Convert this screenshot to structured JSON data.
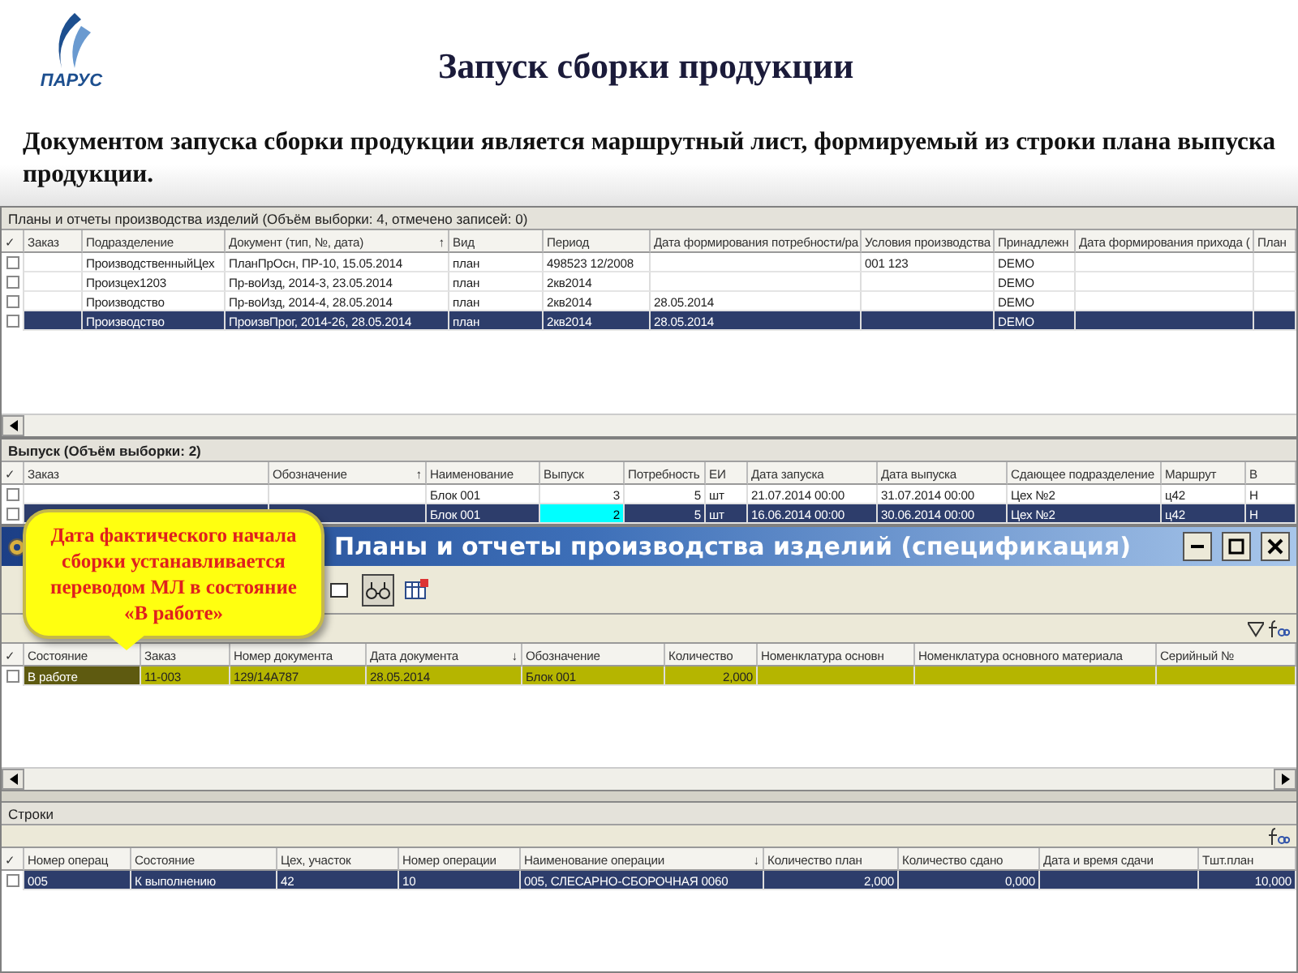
{
  "logo": {
    "text": "ПАРУС"
  },
  "slide": {
    "title": "Запуск сборки продукции",
    "text": "Документом запуска сборки продукции является маршрутный лист, формируемый из строки плана выпуска продукции."
  },
  "plans_window": {
    "caption": "Планы и отчеты производства изделий (Объём выборки: 4, отмечено записей: 0)",
    "check_header": "✓",
    "columns": [
      {
        "label": "Заказ"
      },
      {
        "label": "Подразделение"
      },
      {
        "label": "Документ (тип, №, дата)",
        "sort": "↑"
      },
      {
        "label": "Вид"
      },
      {
        "label": "Период"
      },
      {
        "label": "Дата формирования потребности/ра"
      },
      {
        "label": "Условия производства"
      },
      {
        "label": "Принадлежн"
      },
      {
        "label": "Дата формирования прихода ("
      },
      {
        "label": "План"
      }
    ],
    "rows": [
      {
        "checked": false,
        "selected": false,
        "cells": [
          "",
          "ПроизводственныйЦех",
          "ПланПрОсн, ПР-10, 15.05.2014",
          "план",
          "498523 12/2008",
          "",
          "001 123",
          "DEMO",
          "",
          ""
        ]
      },
      {
        "checked": false,
        "selected": false,
        "cells": [
          "",
          "Произцех1203",
          "Пр-воИзд, 2014-3, 23.05.2014",
          "план",
          "2кв2014",
          "",
          "",
          "DEMO",
          "",
          ""
        ]
      },
      {
        "checked": false,
        "selected": false,
        "cells": [
          "",
          "Производство",
          "Пр-воИзд, 2014-4, 28.05.2014",
          "план",
          "2кв2014",
          "28.05.2014",
          "",
          "DEMO",
          "",
          ""
        ]
      },
      {
        "checked": false,
        "selected": true,
        "cells": [
          "",
          "Производство",
          "ПроизвПрог, 2014-26, 28.05.2014",
          "план",
          "2кв2014",
          "28.05.2014",
          "",
          "DEMO",
          "",
          ""
        ]
      }
    ]
  },
  "release_panel": {
    "caption": "Выпуск (Объём выборки: 2)",
    "check_header": "✓",
    "columns": [
      {
        "label": "Заказ"
      },
      {
        "label": "Обозначение",
        "sort": "↑"
      },
      {
        "label": "Наименование"
      },
      {
        "label": "Выпуск",
        "numeric": true
      },
      {
        "label": "Потребность",
        "numeric": true
      },
      {
        "label": "ЕИ"
      },
      {
        "label": "Дата запуска"
      },
      {
        "label": "Дата выпуска"
      },
      {
        "label": "Сдающее подразделение"
      },
      {
        "label": "Маршрут"
      },
      {
        "label": "В"
      }
    ],
    "rows": [
      {
        "checked": false,
        "selected": false,
        "cells": [
          "",
          "",
          "Блок 001",
          "3",
          "5",
          "шт",
          "21.07.2014 00:00",
          "31.07.2014 00:00",
          "Цех №2",
          "ц42",
          "Н"
        ]
      },
      {
        "checked": false,
        "selected": true,
        "cells": [
          "",
          "",
          "Блок 001",
          {
            "text": "2",
            "editing": true
          },
          "5",
          "шт",
          "16.06.2014 00:00",
          "30.06.2014 00:00",
          "Цех №2",
          "ц42",
          "Н"
        ]
      }
    ]
  },
  "spec_window": {
    "title": "Планы и отчеты производства изделий (спецификация)",
    "focused": false,
    "check_header": "✓",
    "columns": [
      {
        "label": "Состояние"
      },
      {
        "label": "Заказ"
      },
      {
        "label": "Номер документа"
      },
      {
        "label": "Дата документа",
        "sort": "↓"
      },
      {
        "label": "Обозначение"
      },
      {
        "label": "Количество",
        "numeric": true
      },
      {
        "label": "Номенклатура основн"
      },
      {
        "label": "Номенклатура основного материала"
      },
      {
        "label": "Серийный №"
      }
    ],
    "rows": [
      {
        "checked": false,
        "selected": true,
        "cells": [
          "В работе",
          "11-003",
          "129/14А787",
          "28.05.2014",
          "Блок 001",
          "2,000",
          "",
          "",
          ""
        ]
      }
    ]
  },
  "rows_panel": {
    "caption": "Строки",
    "focused": true,
    "check_header": "✓",
    "columns": [
      {
        "label": "Номер операц"
      },
      {
        "label": "Состояние"
      },
      {
        "label": "Цех, участок"
      },
      {
        "label": "Номер операции"
      },
      {
        "label": "Наименование операции",
        "sort": "↓"
      },
      {
        "label": "Количество план",
        "numeric": true
      },
      {
        "label": "Количество сдано",
        "numeric": true
      },
      {
        "label": "Дата и время сдачи"
      },
      {
        "label": "Тшт.план",
        "numeric": true
      }
    ],
    "rows": [
      {
        "checked": false,
        "selected": true,
        "cells": [
          "005",
          "К выполнению",
          "42",
          "10",
          "005, СЛЕСАРНО-СБОРОЧНАЯ 0060",
          "2,000",
          "0,000",
          "",
          "10,000"
        ]
      }
    ]
  },
  "callout": {
    "text": "Дата фактического начала сборки устанавливается переводом МЛ в состояние «В работе»"
  }
}
